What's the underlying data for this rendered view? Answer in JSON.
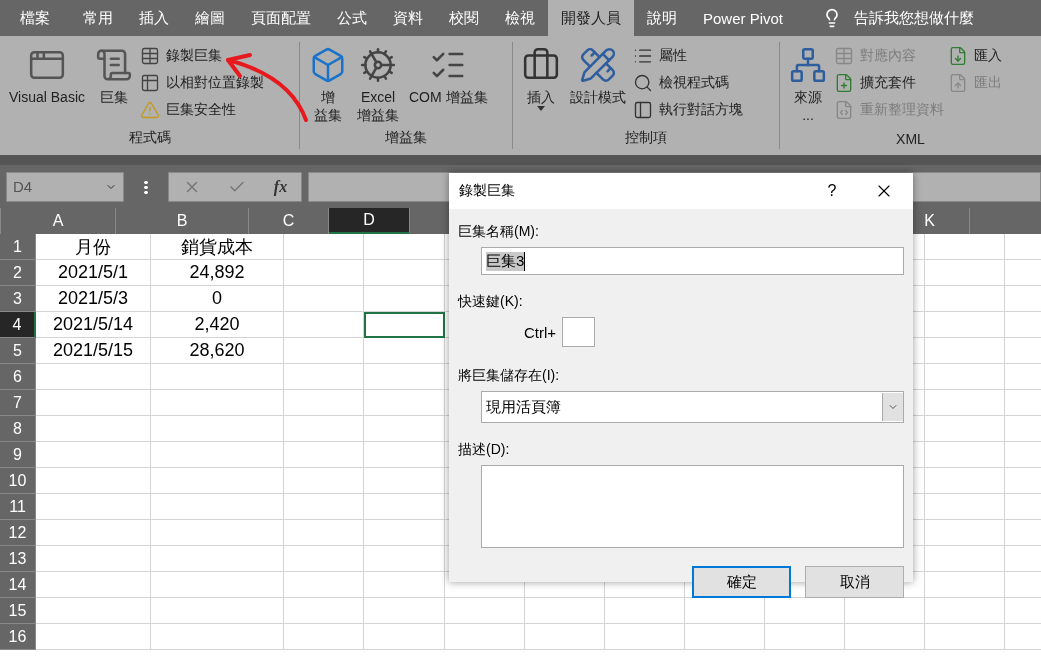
{
  "menu_tabs": [
    {
      "label": "檔案",
      "selected": false
    },
    {
      "label": "常用",
      "selected": false
    },
    {
      "label": "插入",
      "selected": false
    },
    {
      "label": "繪圖",
      "selected": false
    },
    {
      "label": "頁面配置",
      "selected": false
    },
    {
      "label": "公式",
      "selected": false
    },
    {
      "label": "資料",
      "selected": false
    },
    {
      "label": "校閱",
      "selected": false
    },
    {
      "label": "檢視",
      "selected": false
    },
    {
      "label": "開發人員",
      "selected": true
    },
    {
      "label": "說明",
      "selected": false
    },
    {
      "label": "Power Pivot",
      "selected": false
    }
  ],
  "tell_me": "告訴我您想做什麼",
  "ribbon_groups": [
    {
      "label": "程式碼",
      "items": [
        {
          "kind": "large",
          "lines": [
            "Visual Basic"
          ],
          "disabled": false
        },
        {
          "kind": "large",
          "lines": [
            "巨集"
          ],
          "disabled": false
        },
        {
          "kind": "small",
          "lines": [
            "錄製巨集"
          ],
          "disabled": false
        },
        {
          "kind": "small",
          "lines": [
            "以相對位置錄製"
          ],
          "disabled": false
        },
        {
          "kind": "small",
          "lines": [
            "巨集安全性"
          ],
          "disabled": false
        }
      ]
    },
    {
      "label": "增益集",
      "items": [
        {
          "kind": "large",
          "lines": [
            "增",
            "益集"
          ],
          "disabled": false
        },
        {
          "kind": "large",
          "lines": [
            "Excel",
            "增益集"
          ],
          "disabled": false
        },
        {
          "kind": "large",
          "lines": [
            "COM 增益集"
          ],
          "disabled": false
        }
      ]
    },
    {
      "label": "控制項",
      "items": [
        {
          "kind": "large",
          "lines": [
            "插入"
          ],
          "dropdown": true,
          "disabled": false
        },
        {
          "kind": "large",
          "lines": [
            "設計模式"
          ],
          "disabled": false
        },
        {
          "kind": "small",
          "lines": [
            "屬性"
          ],
          "disabled": false
        },
        {
          "kind": "small",
          "lines": [
            "檢視程式碼"
          ],
          "disabled": false
        },
        {
          "kind": "small",
          "lines": [
            "執行對話方塊"
          ],
          "disabled": false
        }
      ]
    },
    {
      "label": "XML",
      "items": [
        {
          "kind": "large",
          "lines": [
            "來源",
            "..."
          ],
          "disabled": false
        },
        {
          "kind": "small",
          "lines": [
            "對應內容"
          ],
          "disabled": true
        },
        {
          "kind": "small",
          "lines": [
            "擴充套件"
          ],
          "disabled": false
        },
        {
          "kind": "small",
          "lines": [
            "重新整理資料"
          ],
          "disabled": true
        },
        {
          "kind": "small",
          "lines": [
            "匯入"
          ],
          "disabled": false
        },
        {
          "kind": "small",
          "lines": [
            "匯出"
          ],
          "disabled": true
        }
      ]
    }
  ],
  "name_box": "D4",
  "function_button": "fx",
  "columns": [
    {
      "label": "A",
      "selected": false
    },
    {
      "label": "B",
      "selected": false
    },
    {
      "label": "C",
      "selected": false
    },
    {
      "label": "D",
      "selected": true
    },
    {
      "label": "K",
      "selected": false
    }
  ],
  "rows": [
    {
      "number": "1",
      "selected": false,
      "cells": [
        "月份",
        "銷貨成本"
      ]
    },
    {
      "number": "2",
      "selected": false,
      "cells": [
        "2021/5/1",
        "24,892"
      ]
    },
    {
      "number": "3",
      "selected": false,
      "cells": [
        "2021/5/3",
        "0"
      ]
    },
    {
      "number": "4",
      "selected": true,
      "cells": [
        "2021/5/14",
        "2,420"
      ]
    },
    {
      "number": "5",
      "selected": false,
      "cells": [
        "2021/5/15",
        "28,620"
      ]
    },
    {
      "number": "6",
      "selected": false
    },
    {
      "number": "7",
      "selected": false
    },
    {
      "number": "8",
      "selected": false
    },
    {
      "number": "9",
      "selected": false
    },
    {
      "number": "10",
      "selected": false
    },
    {
      "number": "11",
      "selected": false
    },
    {
      "number": "12",
      "selected": false
    },
    {
      "number": "13",
      "selected": false
    },
    {
      "number": "14",
      "selected": false
    },
    {
      "number": "15",
      "selected": false
    },
    {
      "number": "16",
      "selected": false
    }
  ],
  "dialog": {
    "title": "錄製巨集",
    "help": "?",
    "name_label": "巨集名稱(M):",
    "name_value": "巨集3",
    "shortcut_label": "快速鍵(K):",
    "shortcut_prefix": "Ctrl+",
    "store_label": "將巨集儲存在(I):",
    "store_value": "現用活頁簿",
    "description_label": "描述(D):",
    "buttons": [
      {
        "label": "確定",
        "default": true
      },
      {
        "label": "取消",
        "default": false
      }
    ]
  }
}
